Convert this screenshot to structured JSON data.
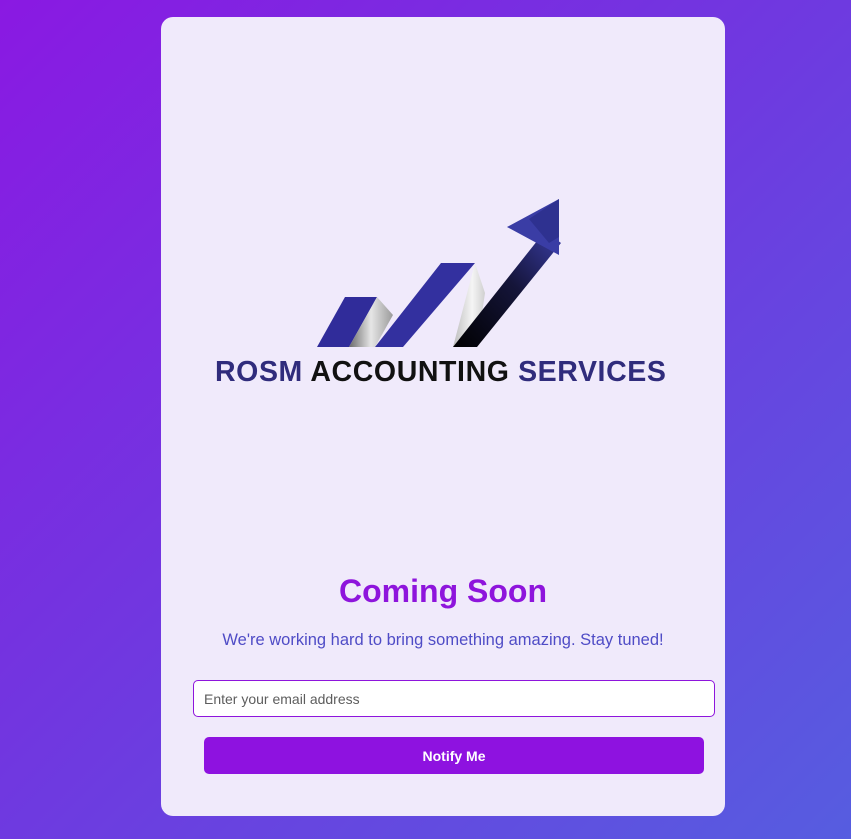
{
  "brand": {
    "logo_text_part1": "ROSM",
    "logo_text_part2": "ACCOUNTING",
    "logo_text_part3": "SERVICES",
    "colors": {
      "navy": "#302c7c",
      "black": "#111111",
      "arrow_blue": "#3a3da5"
    }
  },
  "main": {
    "title": "Coming Soon",
    "subtitle": "We're working hard to bring something amazing. Stay tuned!",
    "accent_color": "#8e15dc"
  },
  "form": {
    "email_placeholder": "Enter your email address",
    "email_value": "",
    "submit_label": "Notify Me"
  }
}
